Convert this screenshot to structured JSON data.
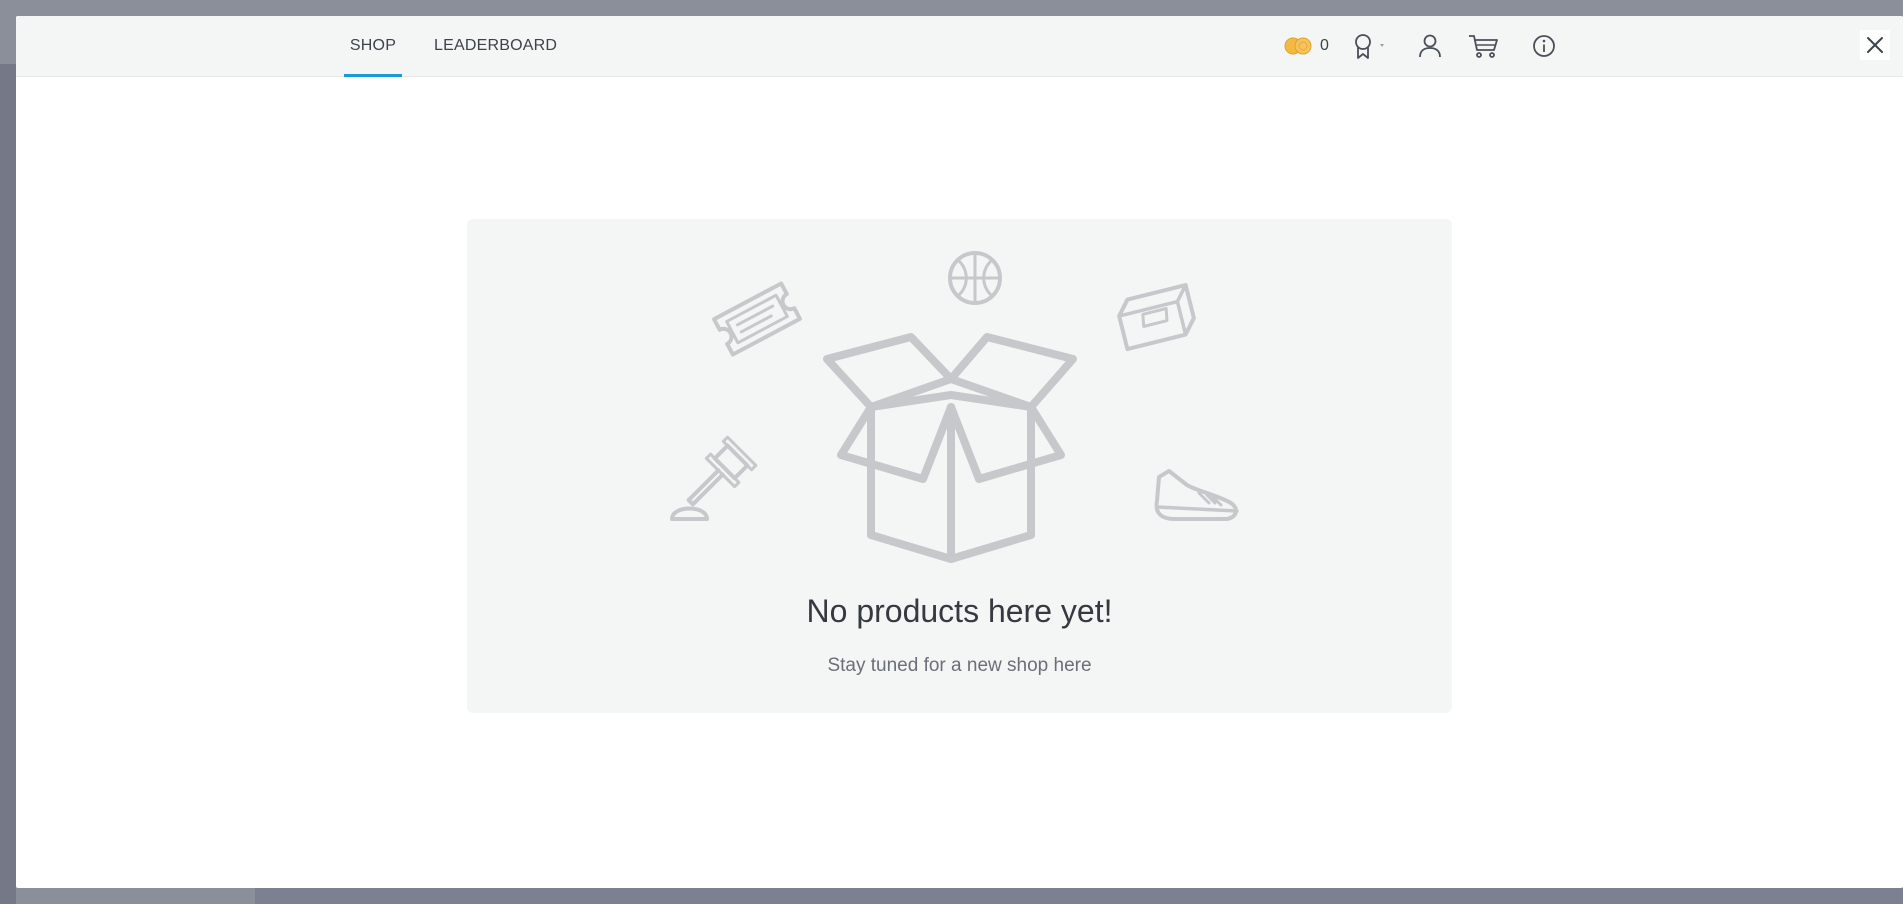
{
  "tabs": [
    {
      "label": "SHOP",
      "active": true
    },
    {
      "label": "LEADERBOARD",
      "active": false
    }
  ],
  "header": {
    "coins": {
      "icon": "coins-icon",
      "count": "0"
    },
    "icons": [
      "award-icon",
      "user-icon",
      "cart-icon",
      "info-icon",
      "close-icon"
    ]
  },
  "empty_state": {
    "title": "No products here yet!",
    "subtitle": "Stay tuned for a new shop here",
    "illustrations": [
      "ticket-icon",
      "basketball-icon",
      "book-icon",
      "gavel-icon",
      "open-box-icon",
      "sneaker-icon"
    ]
  },
  "colors": {
    "accent": "#1a9bd7",
    "coin": "#f4b942",
    "icon_gray": "#c6c8cb",
    "card_bg": "#f4f5f5"
  }
}
